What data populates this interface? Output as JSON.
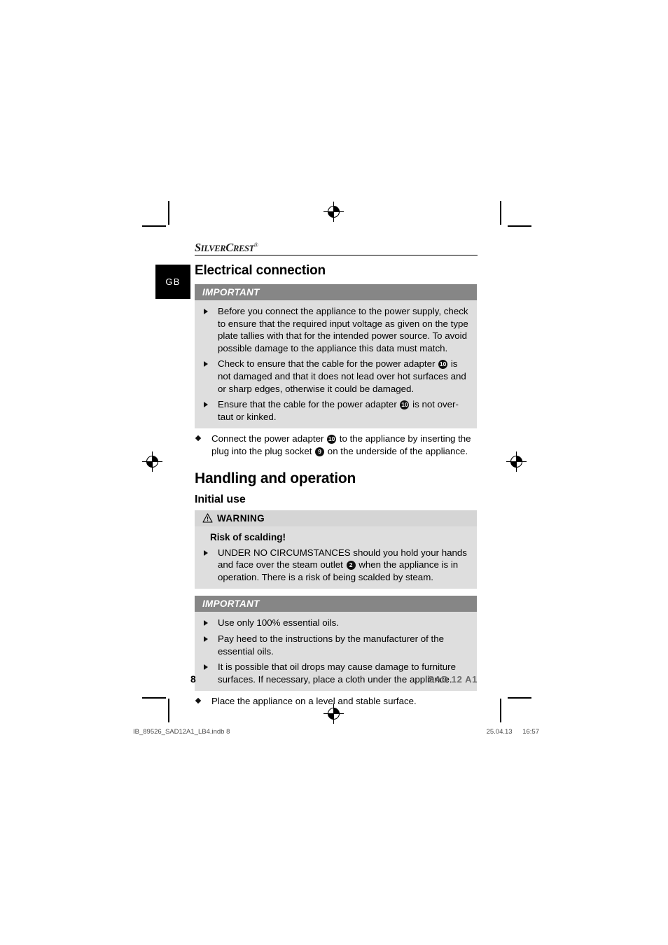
{
  "brand": {
    "name_part1": "S",
    "name_part2": "ILVER",
    "name_part3": "C",
    "name_part4": "REST",
    "trademark": "®"
  },
  "language_tab": {
    "label": "GB"
  },
  "sections": {
    "electrical_connection": {
      "title": "Electrical connection",
      "notice": {
        "header": "IMPORTANT",
        "items": [
          "Before you connect the appliance to the power supply, check to ensure that the required input voltage as given on the type plate tallies with that for the intended power source. To avoid possible damage to the appliance this data must match.",
          "Check to ensure that the cable for the power adapter ⑩ is not damaged and that it does not lead over hot surfaces and or sharp edges, otherwise it could be damaged.",
          "Ensure that the cable for the power adapter ⑩ is not over-taut or kinked."
        ]
      },
      "actions": [
        "Connect the power adapter ⑩ to the appliance by inserting the plug into the plug socket ⑨ on the underside of the appliance."
      ]
    },
    "handling_and_operation": {
      "title": "Handling and operation",
      "initial_use": {
        "title": "Initial use",
        "warning": {
          "header": "WARNING",
          "icon": "warning-triangle-icon",
          "subheading": "Risk of scalding!",
          "items": [
            "UNDER NO CIRCUMSTANCES should you hold your hands and face over the steam outlet ② when the appliance is in operation. There is a risk of being scalded by steam."
          ]
        },
        "notice": {
          "header": "IMPORTANT",
          "items": [
            "Use only 100% essential oils.",
            "Pay heed to the instructions by the manufacturer of the essential oils.",
            "It is possible that oil drops may cause damage to furniture surfaces. If necessary, place a cloth under the appliance."
          ]
        },
        "actions": [
          "Place the appliance on a level and stable surface."
        ]
      }
    }
  },
  "footer": {
    "page_number": "8",
    "model": "SAD 12 A1"
  },
  "print_slug": {
    "filename": "IB_89526_SAD12A1_LB4.indb   8",
    "date": "25.04.13",
    "time": "16:57"
  },
  "refs": {
    "power_adapter": "10",
    "plug_socket": "9",
    "steam_outlet": "2"
  },
  "colors": {
    "important_header_bg": "#868686",
    "notice_body_bg": "#dedede",
    "warning_header_bg": "#d5d5d5",
    "lang_tab_bg": "#000000",
    "model_text": "#6b6b6b"
  }
}
